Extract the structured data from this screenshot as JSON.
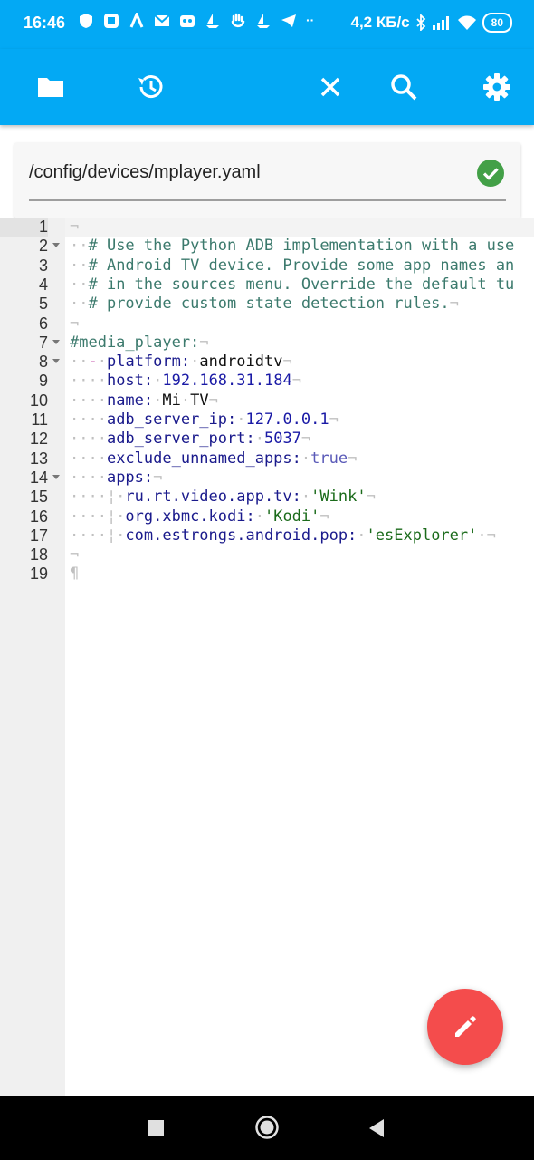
{
  "status_bar": {
    "time": "16:46",
    "speed": "4,2 КБ/с",
    "battery": "80"
  },
  "toolbar": {
    "icons": [
      "folder-icon",
      "history-icon",
      "close-icon",
      "search-icon",
      "settings-icon"
    ]
  },
  "file": {
    "path": "/config/devices/mplayer.yaml",
    "status_icon": "check-circle-icon",
    "status_color": "#43a047"
  },
  "editor": {
    "lines": [
      {
        "n": "1",
        "fold": false,
        "html": "<span class='ws'>¬</span>"
      },
      {
        "n": "2",
        "fold": true,
        "html": "<span class='ws'>··</span><span class='cm'># Use the Python ADB implementation with a use</span>"
      },
      {
        "n": "3",
        "fold": false,
        "html": "<span class='ws'>··</span><span class='cm'># Android TV device. Provide some app names an</span>"
      },
      {
        "n": "4",
        "fold": false,
        "html": "<span class='ws'>··</span><span class='cm'># in the sources menu. Override the default tu</span>"
      },
      {
        "n": "5",
        "fold": false,
        "html": "<span class='ws'>··</span><span class='cm'># provide custom state detection rules.</span><span class='ws'>¬</span>"
      },
      {
        "n": "6",
        "fold": false,
        "html": "<span class='ws'>¬</span>"
      },
      {
        "n": "7",
        "fold": true,
        "html": "<span class='cm'>#media_player:</span><span class='ws'>¬</span>"
      },
      {
        "n": "8",
        "fold": true,
        "html": "<span class='ws'>··</span><span class='dash'>-</span><span class='ws'>·</span><span class='key'>platform:</span><span class='ws'>·</span><span class='plain'>androidtv</span><span class='ws'>¬</span>"
      },
      {
        "n": "9",
        "fold": false,
        "html": "<span class='ws'>····</span><span class='key'>host:</span><span class='ws'>·</span><span class='num'>192.168.31.184</span><span class='ws'>¬</span>"
      },
      {
        "n": "10",
        "fold": false,
        "html": "<span class='ws'>····</span><span class='key'>name:</span><span class='ws'>·</span><span class='plain'>Mi</span><span class='ws'>·</span><span class='plain'>TV</span><span class='ws'>¬</span>"
      },
      {
        "n": "11",
        "fold": false,
        "html": "<span class='ws'>····</span><span class='key'>adb_server_ip:</span><span class='ws'>·</span><span class='num'>127.0.0.1</span><span class='ws'>¬</span>"
      },
      {
        "n": "12",
        "fold": false,
        "html": "<span class='ws'>····</span><span class='key'>adb_server_port:</span><span class='ws'>·</span><span class='num'>5037</span><span class='ws'>¬</span>"
      },
      {
        "n": "13",
        "fold": false,
        "html": "<span class='ws'>····</span><span class='key'>exclude_unnamed_apps:</span><span class='ws'>·</span><span class='boolv'>true</span><span class='ws'>¬</span>"
      },
      {
        "n": "14",
        "fold": true,
        "html": "<span class='ws'>····</span><span class='key'>apps:</span><span class='ws'>¬</span>"
      },
      {
        "n": "15",
        "fold": false,
        "html": "<span class='ws'>····¦·</span><span class='key'>ru.rt.video.app.tv:</span><span class='ws'>·</span><span class='str'>'Wink'</span><span class='ws'>¬</span>"
      },
      {
        "n": "16",
        "fold": false,
        "html": "<span class='ws'>····¦·</span><span class='key'>org.xbmc.kodi:</span><span class='ws'>·</span><span class='str'>'Kodi'</span><span class='ws'>¬</span>"
      },
      {
        "n": "17",
        "fold": false,
        "html": "<span class='ws'>····¦·</span><span class='key'>com.estrongs.android.pop:</span><span class='ws'>·</span><span class='str'>'esExplorer'</span><span class='ws'>·¬</span>"
      },
      {
        "n": "18",
        "fold": false,
        "html": "<span class='ws'>¬</span>"
      },
      {
        "n": "19",
        "fold": false,
        "html": "<span class='ws'>¶</span>"
      }
    ]
  },
  "fab": {
    "icon": "pencil-icon",
    "color": "#f44c4c"
  },
  "nav": {
    "icons": [
      "recents-square-icon",
      "home-circle-icon",
      "back-triangle-icon"
    ]
  }
}
